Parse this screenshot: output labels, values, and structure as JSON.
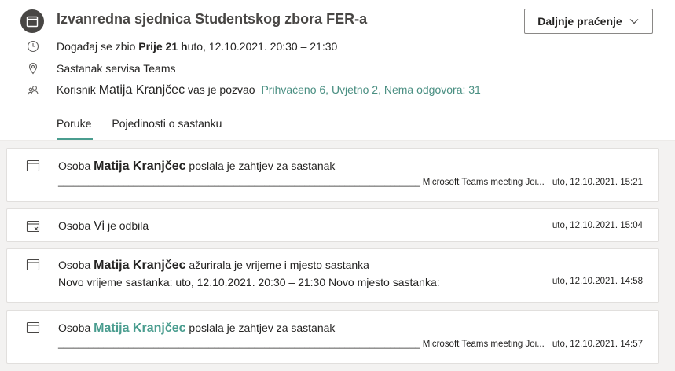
{
  "meeting": {
    "title": "Izvanredna sjednica Studentskog zbora FER-a",
    "follow_button": "Daljnje praćenje",
    "time_prefix": "Događaj se zbio ",
    "time_bold": "Prije 21 h",
    "time_suffix": "uto, 12.10.2021. 20:30 – 21:30",
    "location": "Sastanak servisa Teams",
    "organizer_prefix": "Korisnik ",
    "organizer_name": "Matija Kranjčec",
    "organizer_suffix": " vas je pozvao",
    "rsvp_summary": "Prihvaćeno 6, Uvjetno 2, Nema odgovora: 31"
  },
  "tabs": [
    {
      "label": "Poruke",
      "active": true
    },
    {
      "label": "Pojedinosti o sastanku",
      "active": false
    }
  ],
  "messages": [
    {
      "icon": "calendar-icon",
      "prefix": "Osoba ",
      "actor": "Matija Kranjčec",
      "action": " poslala je zahtjev za sastanak",
      "detail": "________________________________________________________________________  Microsoft Teams meeting Joi...",
      "time": "uto, 12.10.2021. 15:21"
    },
    {
      "icon": "calendar-declined-icon",
      "prefix": "Osoba ",
      "actor": "Vi",
      "action": " je odbila",
      "detail": "",
      "time": "uto, 12.10.2021. 15:04"
    },
    {
      "icon": "calendar-icon",
      "prefix": "Osoba ",
      "actor": "Matija Kranjčec",
      "action": " ažurirala je vrijeme i mjesto sastanka",
      "detail": "Novo vrijeme sastanka: uto, 12.10.2021. 20:30 – 21:30  Novo mjesto sastanka:",
      "time": "uto, 12.10.2021. 14:58"
    },
    {
      "icon": "calendar-icon",
      "prefix": "Osoba ",
      "actor": "Matija Kranjčec",
      "action": " poslala je zahtjev za sastanak",
      "detail": "________________________________________________________________________  Microsoft Teams meeting Joi...",
      "time": "uto, 12.10.2021. 14:57"
    }
  ],
  "colors": {
    "accent": "#4a9d8f",
    "feed_background": "#f3f2f1",
    "text": "#252423"
  }
}
